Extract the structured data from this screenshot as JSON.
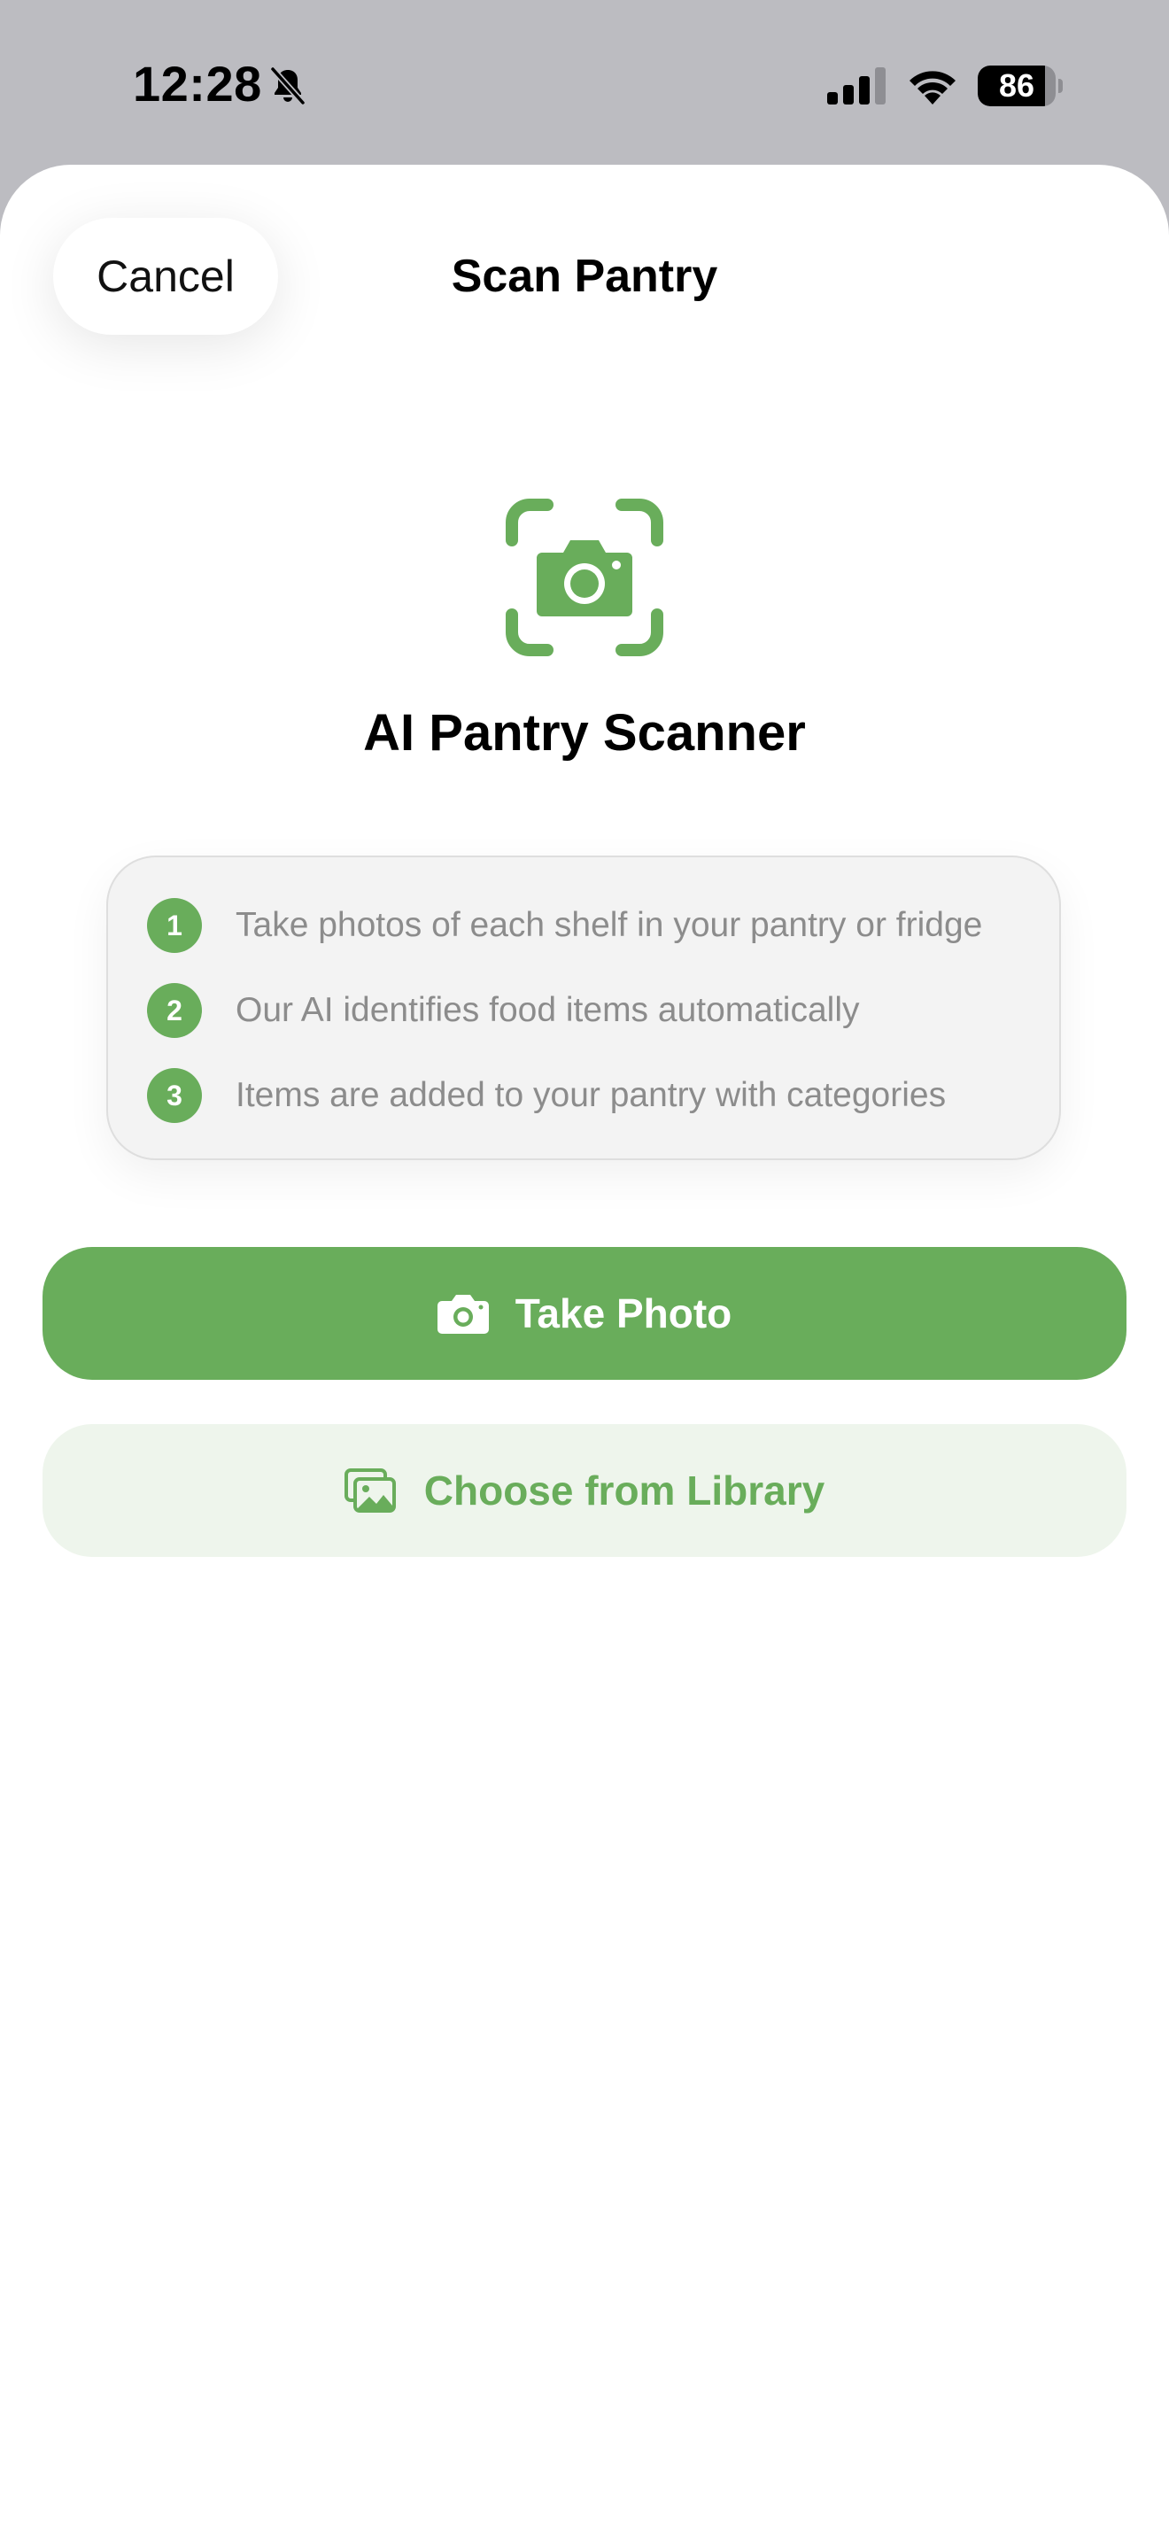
{
  "status_bar": {
    "time": "12:28",
    "silent_icon": "bell-slash-icon",
    "signal_icon": "cellular-signal-icon",
    "wifi_icon": "wifi-icon",
    "battery_percent": "86",
    "battery_level": 0.86
  },
  "sheet": {
    "cancel_label": "Cancel",
    "title": "Scan Pantry"
  },
  "hero": {
    "icon": "camera-viewfinder-icon",
    "title": "AI Pantry Scanner"
  },
  "steps": [
    {
      "number": "1",
      "text": "Take photos of each shelf in your pantry or fridge"
    },
    {
      "number": "2",
      "text": "Our AI identifies food items automatically"
    },
    {
      "number": "3",
      "text": "Items are added to your pantry with categories"
    }
  ],
  "actions": {
    "take_photo": {
      "label": "Take Photo",
      "icon": "camera-icon"
    },
    "choose_library": {
      "label": "Choose from Library",
      "icon": "photo-library-icon"
    }
  },
  "colors": {
    "accent": "#69ad5b",
    "accent_light": "#eef5ec",
    "status_bar_background": "#bcbcc1",
    "card_background": "#f3f3f3"
  }
}
